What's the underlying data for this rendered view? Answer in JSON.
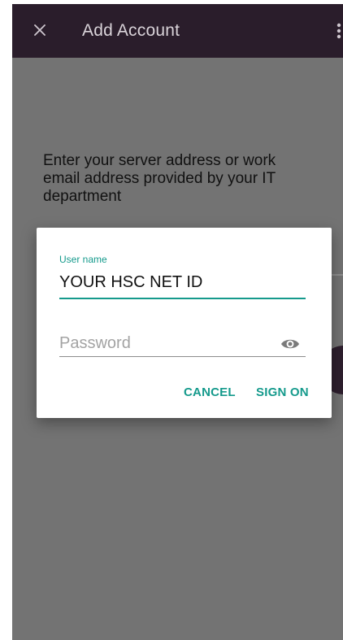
{
  "appbar": {
    "title": "Add Account",
    "close_icon": "close-icon",
    "more_icon": "more-vert-icon"
  },
  "prompt": {
    "text": "Enter your server address or work email address provided by your IT department"
  },
  "dialog": {
    "username_label": "User name",
    "username_value": "YOUR HSC NET ID",
    "password_placeholder": "Password",
    "password_toggle_icon": "eye-icon",
    "cancel_label": "CANCEL",
    "sign_on_label": "SIGN ON"
  },
  "colors": {
    "accent": "#159a8c",
    "appbar": "#2a1d2b",
    "scrim": "#737373"
  }
}
